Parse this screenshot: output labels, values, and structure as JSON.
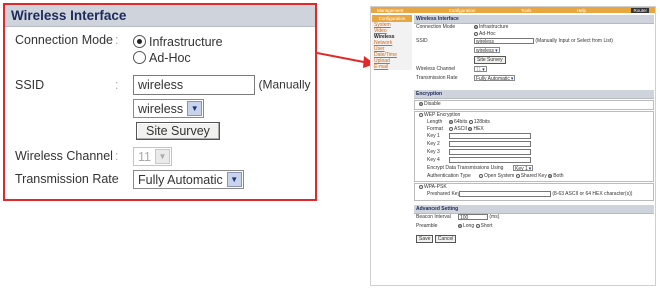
{
  "zoom": {
    "section_title": "Wireless Interface",
    "connection_mode_label": "Connection Mode",
    "colon": ":",
    "mode_infrastructure": "Infrastructure",
    "mode_adhoc": "Ad-Hoc",
    "ssid_label": "SSID",
    "ssid_value": "wireless",
    "ssid_hint": "(Manually Inp",
    "ssid_select": "wireless",
    "site_survey": "Site Survey",
    "channel_label": "Wireless Channel",
    "channel_value": "11",
    "rate_label": "Transmission Rate",
    "rate_value": "Fully Automatic"
  },
  "shot": {
    "nav": [
      "Management",
      "Configuration",
      "Tools",
      "Help",
      "Router"
    ],
    "sidebar": {
      "title": "Configuration",
      "items": [
        "System",
        "Video",
        "Wireless",
        "Network",
        "User",
        "Date/Time",
        "Upload",
        "E-mail"
      ]
    },
    "wireless": {
      "title": "Wireless Interface",
      "connection_mode_label": "Connection Mode",
      "mode_infrastructure": "Infrastructure",
      "mode_adhoc": "Ad-Hoc",
      "ssid_label": "SSID",
      "ssid_value": "wireless",
      "ssid_hint": "(Manually Input or Select from List)",
      "ssid_select": "wireless",
      "site_survey": "Site Survey",
      "channel_label": "Wireless Channel",
      "channel_value": "11",
      "rate_label": "Transmission Rate",
      "rate_value": "Fully Automatic"
    },
    "encryption": {
      "title": "Encryption",
      "disable": "Disable",
      "wep": "WEP Encryption",
      "length_label": "Length",
      "len_64": "64bits",
      "len_128": "128bits",
      "format_label": "Format",
      "fmt_ascii": "ASCII",
      "fmt_hex": "HEX",
      "key1": "Key 1",
      "key2": "Key 2",
      "key3": "Key 3",
      "key4": "Key 4",
      "encrypt_using": "Encrypt Data Transmissions Using",
      "key_select": "Key 1",
      "auth_label": "Authentication Type",
      "auth_open": "Open System",
      "auth_shared": "Shared Key",
      "auth_both": "Both",
      "wpa": "WPA-PSK",
      "psk_label": "Preshared Key",
      "psk_hint": "(8-63 ASCII or 64 HEX character(s))"
    },
    "advanced": {
      "title": "Advanced Setting",
      "beacon_label": "Beacon Interval",
      "beacon_value": "100",
      "beacon_unit": "(ms)",
      "preamble_label": "Preamble",
      "pre_long": "Long",
      "pre_short": "Short"
    },
    "save": "Save",
    "cancel": "Cancel"
  },
  "colors": {
    "callout_border": "#e02a2a",
    "section_bg": "#cfd3dc",
    "nav_bg": "#e8a640"
  }
}
